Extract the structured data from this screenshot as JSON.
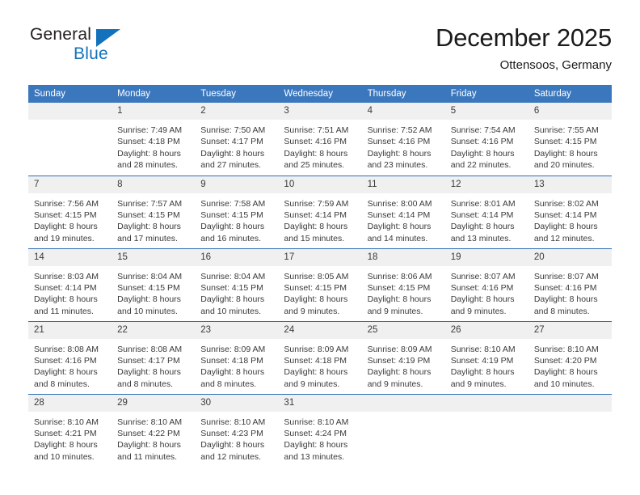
{
  "brand": {
    "name_dark": "General",
    "name_blue": "Blue",
    "accent_color": "#1272bb"
  },
  "header": {
    "title": "December 2025",
    "location": "Ottensoos, Germany"
  },
  "theme": {
    "header_blue": "#3b77bd",
    "row_divider_blue": "#2f6fb5",
    "daynum_background": "#f0f0f0"
  },
  "calendar": {
    "weekday_headers": [
      "Sunday",
      "Monday",
      "Tuesday",
      "Wednesday",
      "Thursday",
      "Friday",
      "Saturday"
    ],
    "weeks": [
      [
        {
          "day": "",
          "lines": []
        },
        {
          "day": "1",
          "lines": [
            "Sunrise: 7:49 AM",
            "Sunset: 4:18 PM",
            "Daylight: 8 hours",
            "and 28 minutes."
          ]
        },
        {
          "day": "2",
          "lines": [
            "Sunrise: 7:50 AM",
            "Sunset: 4:17 PM",
            "Daylight: 8 hours",
            "and 27 minutes."
          ]
        },
        {
          "day": "3",
          "lines": [
            "Sunrise: 7:51 AM",
            "Sunset: 4:16 PM",
            "Daylight: 8 hours",
            "and 25 minutes."
          ]
        },
        {
          "day": "4",
          "lines": [
            "Sunrise: 7:52 AM",
            "Sunset: 4:16 PM",
            "Daylight: 8 hours",
            "and 23 minutes."
          ]
        },
        {
          "day": "5",
          "lines": [
            "Sunrise: 7:54 AM",
            "Sunset: 4:16 PM",
            "Daylight: 8 hours",
            "and 22 minutes."
          ]
        },
        {
          "day": "6",
          "lines": [
            "Sunrise: 7:55 AM",
            "Sunset: 4:15 PM",
            "Daylight: 8 hours",
            "and 20 minutes."
          ]
        }
      ],
      [
        {
          "day": "7",
          "lines": [
            "Sunrise: 7:56 AM",
            "Sunset: 4:15 PM",
            "Daylight: 8 hours",
            "and 19 minutes."
          ]
        },
        {
          "day": "8",
          "lines": [
            "Sunrise: 7:57 AM",
            "Sunset: 4:15 PM",
            "Daylight: 8 hours",
            "and 17 minutes."
          ]
        },
        {
          "day": "9",
          "lines": [
            "Sunrise: 7:58 AM",
            "Sunset: 4:15 PM",
            "Daylight: 8 hours",
            "and 16 minutes."
          ]
        },
        {
          "day": "10",
          "lines": [
            "Sunrise: 7:59 AM",
            "Sunset: 4:14 PM",
            "Daylight: 8 hours",
            "and 15 minutes."
          ]
        },
        {
          "day": "11",
          "lines": [
            "Sunrise: 8:00 AM",
            "Sunset: 4:14 PM",
            "Daylight: 8 hours",
            "and 14 minutes."
          ]
        },
        {
          "day": "12",
          "lines": [
            "Sunrise: 8:01 AM",
            "Sunset: 4:14 PM",
            "Daylight: 8 hours",
            "and 13 minutes."
          ]
        },
        {
          "day": "13",
          "lines": [
            "Sunrise: 8:02 AM",
            "Sunset: 4:14 PM",
            "Daylight: 8 hours",
            "and 12 minutes."
          ]
        }
      ],
      [
        {
          "day": "14",
          "lines": [
            "Sunrise: 8:03 AM",
            "Sunset: 4:14 PM",
            "Daylight: 8 hours",
            "and 11 minutes."
          ]
        },
        {
          "day": "15",
          "lines": [
            "Sunrise: 8:04 AM",
            "Sunset: 4:15 PM",
            "Daylight: 8 hours",
            "and 10 minutes."
          ]
        },
        {
          "day": "16",
          "lines": [
            "Sunrise: 8:04 AM",
            "Sunset: 4:15 PM",
            "Daylight: 8 hours",
            "and 10 minutes."
          ]
        },
        {
          "day": "17",
          "lines": [
            "Sunrise: 8:05 AM",
            "Sunset: 4:15 PM",
            "Daylight: 8 hours",
            "and 9 minutes."
          ]
        },
        {
          "day": "18",
          "lines": [
            "Sunrise: 8:06 AM",
            "Sunset: 4:15 PM",
            "Daylight: 8 hours",
            "and 9 minutes."
          ]
        },
        {
          "day": "19",
          "lines": [
            "Sunrise: 8:07 AM",
            "Sunset: 4:16 PM",
            "Daylight: 8 hours",
            "and 9 minutes."
          ]
        },
        {
          "day": "20",
          "lines": [
            "Sunrise: 8:07 AM",
            "Sunset: 4:16 PM",
            "Daylight: 8 hours",
            "and 8 minutes."
          ]
        }
      ],
      [
        {
          "day": "21",
          "lines": [
            "Sunrise: 8:08 AM",
            "Sunset: 4:16 PM",
            "Daylight: 8 hours",
            "and 8 minutes."
          ]
        },
        {
          "day": "22",
          "lines": [
            "Sunrise: 8:08 AM",
            "Sunset: 4:17 PM",
            "Daylight: 8 hours",
            "and 8 minutes."
          ]
        },
        {
          "day": "23",
          "lines": [
            "Sunrise: 8:09 AM",
            "Sunset: 4:18 PM",
            "Daylight: 8 hours",
            "and 8 minutes."
          ]
        },
        {
          "day": "24",
          "lines": [
            "Sunrise: 8:09 AM",
            "Sunset: 4:18 PM",
            "Daylight: 8 hours",
            "and 9 minutes."
          ]
        },
        {
          "day": "25",
          "lines": [
            "Sunrise: 8:09 AM",
            "Sunset: 4:19 PM",
            "Daylight: 8 hours",
            "and 9 minutes."
          ]
        },
        {
          "day": "26",
          "lines": [
            "Sunrise: 8:10 AM",
            "Sunset: 4:19 PM",
            "Daylight: 8 hours",
            "and 9 minutes."
          ]
        },
        {
          "day": "27",
          "lines": [
            "Sunrise: 8:10 AM",
            "Sunset: 4:20 PM",
            "Daylight: 8 hours",
            "and 10 minutes."
          ]
        }
      ],
      [
        {
          "day": "28",
          "lines": [
            "Sunrise: 8:10 AM",
            "Sunset: 4:21 PM",
            "Daylight: 8 hours",
            "and 10 minutes."
          ]
        },
        {
          "day": "29",
          "lines": [
            "Sunrise: 8:10 AM",
            "Sunset: 4:22 PM",
            "Daylight: 8 hours",
            "and 11 minutes."
          ]
        },
        {
          "day": "30",
          "lines": [
            "Sunrise: 8:10 AM",
            "Sunset: 4:23 PM",
            "Daylight: 8 hours",
            "and 12 minutes."
          ]
        },
        {
          "day": "31",
          "lines": [
            "Sunrise: 8:10 AM",
            "Sunset: 4:24 PM",
            "Daylight: 8 hours",
            "and 13 minutes."
          ]
        },
        {
          "day": "",
          "lines": []
        },
        {
          "day": "",
          "lines": []
        },
        {
          "day": "",
          "lines": []
        }
      ]
    ]
  }
}
